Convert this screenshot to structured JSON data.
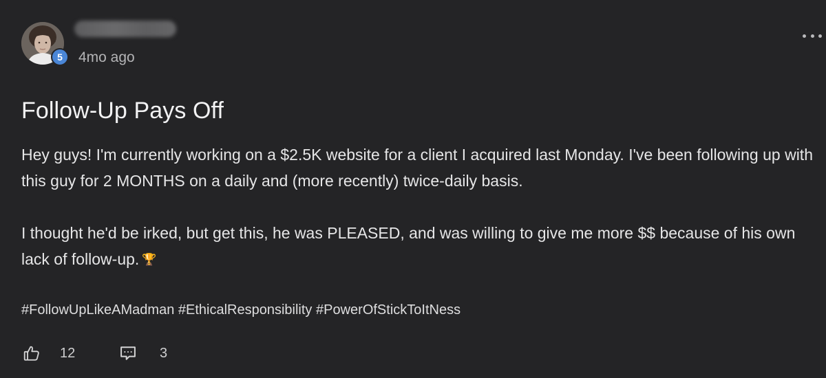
{
  "post": {
    "author": {
      "level": "5",
      "timestamp": "4mo ago"
    },
    "title": "Follow-Up Pays Off",
    "body": {
      "paragraph_1": "Hey guys! I'm currently working on a $2.5K website for a client I acquired last Monday. I've been following up with this guy for 2 MONTHS on a daily and (more recently) twice-daily basis.",
      "paragraph_2": "I thought he'd be irked, but get this, he was PLEASED, and was willing to give me more $$ because of his own lack of follow-up.",
      "emoji": "🏆"
    },
    "hashtags": [
      "#FollowUpLikeAMadman",
      "#EthicalResponsibility",
      "#PowerOfStickToItNess"
    ],
    "actions": {
      "like_count": "12",
      "comment_count": "3"
    },
    "icons": {
      "more": "more-horizontal-icon",
      "like": "thumbs-up-icon",
      "comment": "comment-icon",
      "trophy": "trophy-icon"
    },
    "colors": {
      "background": "#242426",
      "level_badge": "#4a86d6",
      "text": "#e6e6e7",
      "muted_text": "#b4b4b6"
    }
  }
}
